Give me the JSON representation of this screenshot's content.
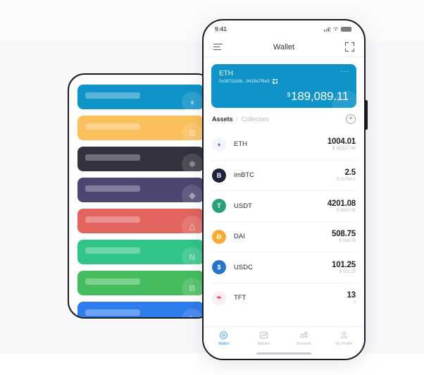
{
  "back_phone": {
    "cards": [
      {
        "color": "#1093c9",
        "glyph": "♦",
        "name": "eth-card"
      },
      {
        "color": "#fbc05b",
        "glyph": "B",
        "name": "btc-card"
      },
      {
        "color": "#33333f",
        "glyph": "⚛",
        "name": "atom-card"
      },
      {
        "color": "#4e4570",
        "glyph": "◈",
        "name": "eos-card"
      },
      {
        "color": "#e2645e",
        "glyph": "△",
        "name": "tron-card"
      },
      {
        "color": "#31c489",
        "glyph": "N",
        "name": "neo-card"
      },
      {
        "color": "#45bd5f",
        "glyph": "B",
        "name": "bch-card"
      },
      {
        "color": "#2f7ced",
        "glyph": "L",
        "name": "ltc-card"
      }
    ]
  },
  "front_phone": {
    "status_bar": {
      "time": "9:41"
    },
    "nav": {
      "title": "Wallet"
    },
    "wallet_card": {
      "name": "ETH",
      "address": "0x08711d3b...8418a7f8e3",
      "more": "···",
      "currency_symbol": "$",
      "balance": "189,089.11"
    },
    "tabs": {
      "assets_label": "Assets",
      "separator": "/",
      "collectibles_label": "Collecties",
      "add_label": "+"
    },
    "assets": [
      {
        "symbol": "ETH",
        "amount": "1004.01",
        "fiat": "$ 162517.48",
        "icon_bg": "#f4f5fa",
        "icon_color": "#6d7ab8",
        "icon_glyph": "♦"
      },
      {
        "symbol": "imBTC",
        "amount": "2.5",
        "fiat": "$ 21760.1",
        "icon_bg": "#1c2240",
        "icon_color": "#ffffff",
        "icon_glyph": "B"
      },
      {
        "symbol": "USDT",
        "amount": "4201.08",
        "fiat": "$ 4201.08",
        "icon_bg": "#26a17b",
        "icon_color": "#ffffff",
        "icon_glyph": "T"
      },
      {
        "symbol": "DAI",
        "amount": "508.75",
        "fiat": "$ 508.75",
        "icon_bg": "#f5ac37",
        "icon_color": "#ffffff",
        "icon_glyph": "Đ"
      },
      {
        "symbol": "USDC",
        "amount": "101.25",
        "fiat": "$ 101.25",
        "icon_bg": "#2775ca",
        "icon_color": "#ffffff",
        "icon_glyph": "$"
      },
      {
        "symbol": "TFT",
        "amount": "13",
        "fiat": "0",
        "icon_bg": "#fdeff1",
        "icon_color": "#e8485f",
        "icon_glyph": "❧"
      }
    ],
    "tab_bar": [
      {
        "label": "Wallet",
        "icon": "wallet-icon",
        "active": true
      },
      {
        "label": "Market",
        "icon": "market-icon",
        "active": false
      },
      {
        "label": "Browser",
        "icon": "browser-icon",
        "active": false
      },
      {
        "label": "My Profile",
        "icon": "profile-icon",
        "active": false
      }
    ]
  },
  "colors": {
    "accent": "#2196e3",
    "card_blue": "#1093c9",
    "frame": "#1b1b1f"
  }
}
